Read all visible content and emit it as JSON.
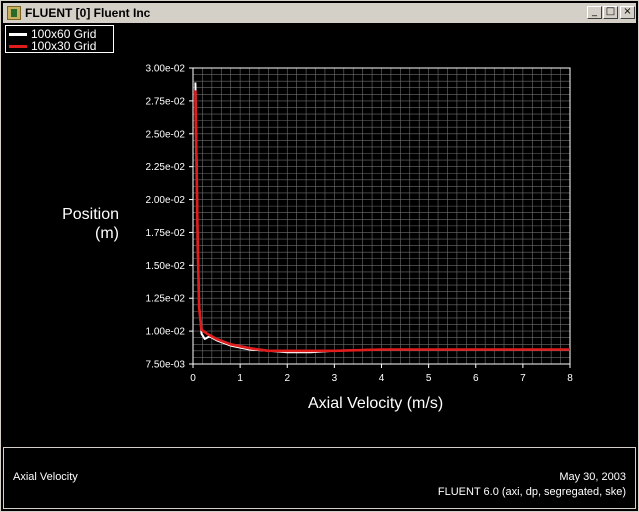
{
  "window": {
    "title": "FLUENT [0] Fluent Inc",
    "buttons": {
      "minimize": "_",
      "maximize": "□",
      "close": "×"
    }
  },
  "footer": {
    "left_text": "Axial Velocity",
    "date": "May 30, 2003",
    "version": "FLUENT 6.0 (axi, dp, segregated, ske)"
  },
  "colors": {
    "background": "#000000",
    "grid": "#6e6e6e",
    "axes": "#ffffff"
  },
  "chart_data": {
    "type": "line",
    "title": "",
    "xlabel": "Axial Velocity (m/s)",
    "ylabel_lines": [
      "Position",
      "(m)"
    ],
    "xlim": [
      0,
      8
    ],
    "ylim": [
      0.0075,
      0.03
    ],
    "x_ticks": [
      "0",
      "1",
      "2",
      "3",
      "4",
      "5",
      "6",
      "7",
      "8"
    ],
    "y_ticks": [
      "7.50e-03",
      "1.00e-02",
      "1.25e-02",
      "1.50e-02",
      "1.75e-02",
      "2.00e-02",
      "2.25e-02",
      "2.50e-02",
      "2.75e-02",
      "3.00e-02"
    ],
    "grid": true,
    "legend_position": "top-left",
    "series": [
      {
        "name": "100x60 Grid",
        "color": "#ffffff",
        "points": [
          [
            0.05,
            0.0289
          ],
          [
            0.06,
            0.027
          ],
          [
            0.08,
            0.022
          ],
          [
            0.1,
            0.017
          ],
          [
            0.13,
            0.012
          ],
          [
            0.18,
            0.0098
          ],
          [
            0.25,
            0.0094
          ],
          [
            0.35,
            0.0096
          ],
          [
            0.5,
            0.0093
          ],
          [
            0.8,
            0.0089
          ],
          [
            1.2,
            0.0086
          ],
          [
            1.6,
            0.0085
          ],
          [
            2.0,
            0.0084
          ],
          [
            2.5,
            0.0084
          ],
          [
            3.0,
            0.0085
          ],
          [
            4.0,
            0.0086
          ],
          [
            5.0,
            0.0086
          ],
          [
            6.0,
            0.0086
          ],
          [
            7.0,
            0.0086
          ],
          [
            8.0,
            0.0086
          ]
        ]
      },
      {
        "name": "100x30 Grid",
        "color": "#e01c1c",
        "points": [
          [
            0.05,
            0.0283
          ],
          [
            0.06,
            0.026
          ],
          [
            0.08,
            0.0215
          ],
          [
            0.1,
            0.0165
          ],
          [
            0.13,
            0.0118
          ],
          [
            0.18,
            0.0101
          ],
          [
            0.3,
            0.0098
          ],
          [
            0.5,
            0.0094
          ],
          [
            0.8,
            0.009
          ],
          [
            1.2,
            0.0087
          ],
          [
            1.6,
            0.0085
          ],
          [
            2.0,
            0.0085
          ],
          [
            2.5,
            0.0085
          ],
          [
            3.0,
            0.0085
          ],
          [
            4.0,
            0.0086
          ],
          [
            5.0,
            0.0086
          ],
          [
            6.0,
            0.0086
          ],
          [
            7.0,
            0.0086
          ],
          [
            8.0,
            0.0086
          ]
        ]
      }
    ]
  }
}
